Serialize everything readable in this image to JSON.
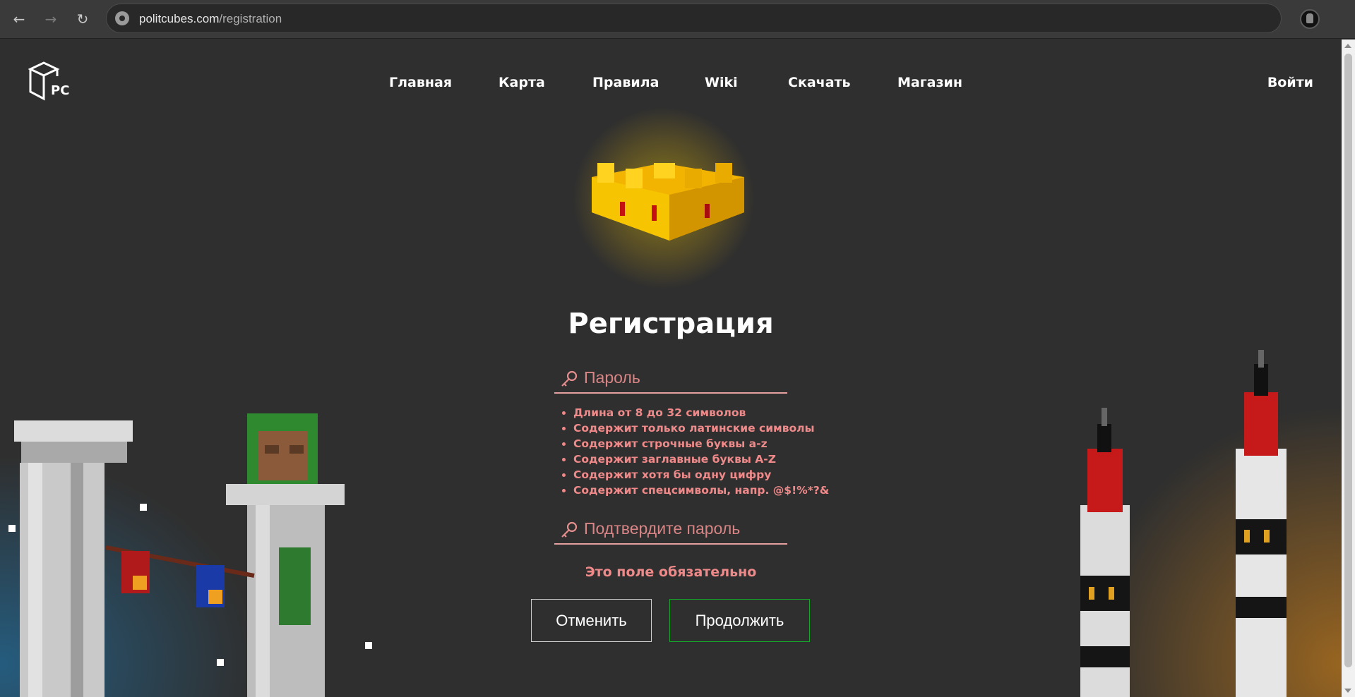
{
  "browser": {
    "url_host": "politcubes.com",
    "url_path": "/registration"
  },
  "header": {
    "logo_text": "PC",
    "menu": [
      "Главная",
      "Карта",
      "Правила",
      "Wiki",
      "Скачать",
      "Магазин"
    ],
    "login_label": "Войти"
  },
  "form": {
    "title": "Регистрация",
    "password_placeholder": "Пароль",
    "password_value": "",
    "rules": [
      "Длина от 8 до 32 символов",
      "Содержит только латинские символы",
      "Содержит строчные буквы a-z",
      "Содержит заглавные буквы A-Z",
      "Содержит хотя бы одну цифру",
      "Содержит спецсимволы, напр. @$!%*?&"
    ],
    "confirm_placeholder": "Подтвердите пароль",
    "confirm_value": "",
    "error_text": "Это поле обязательно",
    "cancel_label": "Отменить",
    "continue_label": "Продолжить"
  },
  "colors": {
    "background": "#2f2f2f",
    "error": "#f08a8a",
    "field_underline": "#e5a0a0",
    "continue_border": "#16a82a",
    "crown": "#f6c200"
  },
  "icons": [
    "back-arrow-icon",
    "forward-arrow-icon",
    "reload-icon",
    "site-info-icon",
    "profile-avatar-icon",
    "key-icon"
  ]
}
